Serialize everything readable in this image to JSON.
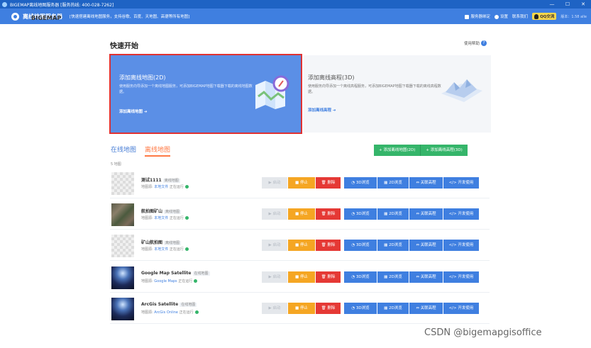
{
  "window": {
    "title": "BIGEMAP离线地图服务器 [服务热线: 400-028-7262]",
    "controls": [
      "—",
      "☐",
      "✕"
    ]
  },
  "header": {
    "brand": "BIGEMAP",
    "product": "离线地图服务器",
    "tagline": "[快速搭建离线地图服务，支持谷歌、百度、天地图、高德等所有地图]",
    "account": "服务器绑定",
    "settings": "设置",
    "contact": "联系我们",
    "qq": "QQ交流",
    "version": "版本：1.58 alle"
  },
  "quickstart": {
    "title": "快速开始",
    "help": "使用帮助",
    "map_card": {
      "title": "添加离线地图(2D)",
      "desc": "使用服务向导添加一个离线地图服务，可添加BIGEMAP地图下载器下载的离线地图数据。",
      "link": "添加离线地图 ➔"
    },
    "elev_card": {
      "title": "添加离线高程(3D)",
      "desc": "使用服务向导添加一个离线高程服务，可添加BIGEMAP地图下载器下载的离线高程数据。",
      "link": "添加离线高程 ➔"
    }
  },
  "tabs": {
    "online": "在线地图",
    "offline": "离线地图"
  },
  "top_buttons": {
    "add_map": "+ 添加离线地图(2D)",
    "add_elev": "+ 添加离线高程(3D)"
  },
  "count_text": "5 地图",
  "actions": {
    "start": "▶ 启动",
    "stop": "■ 停止",
    "delete": "🗑 删除",
    "view3d": "◔ 3D浏览",
    "view2d": "▦ 2D浏览",
    "elev": "⇔ 关联高程",
    "dev": "</> 开发使用"
  },
  "maps": [
    {
      "name": "测试1111",
      "badge": "离线地图",
      "source_label": "地图源:",
      "source": "本地文件",
      "status": "正在运行",
      "thumb": "checker"
    },
    {
      "name": "航拍图矿山",
      "badge": "离线地图",
      "source_label": "地图源:",
      "source": "本地文件",
      "status": "正在运行",
      "thumb": "aerial"
    },
    {
      "name": "矿山航拍图",
      "badge": "离线地图",
      "source_label": "地图源:",
      "source": "本地文件",
      "status": "正在运行",
      "thumb": "checker"
    },
    {
      "name": "Google Map Satellite",
      "badge": "在线地图",
      "source_label": "地图源:",
      "source": "Google Maps",
      "status": "正在运行",
      "thumb": "sat"
    },
    {
      "name": "ArcGis Satellite",
      "badge": "在线地图",
      "source_label": "地图源:",
      "source": "ArcGis Online",
      "status": "正在运行",
      "thumb": "sat"
    }
  ],
  "watermark": "CSDN @bigemapgisoffice",
  "colors": {
    "primary": "#3f7fe0",
    "card_highlight": "#5b8fe6",
    "selection_border": "#e03232",
    "tab_active": "#ff7a45",
    "green": "#35b56a",
    "stop": "#f5a623",
    "delete": "#e53935"
  }
}
